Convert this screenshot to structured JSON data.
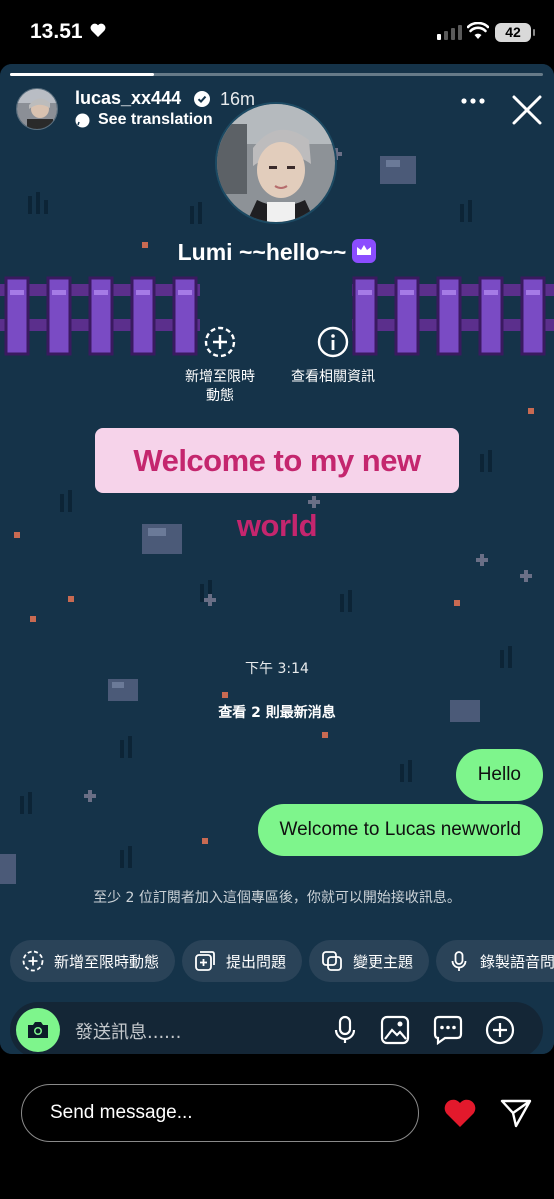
{
  "status_bar": {
    "time": "13.51",
    "battery": "42"
  },
  "story": {
    "progress": 0.27,
    "username": "lucas_xx444",
    "time_ago": "16m",
    "see_translation": "See translation",
    "channel_name": "Lumi ~~hello~~",
    "actions": [
      {
        "label": "新增至限時\n動態",
        "icon": "add-circle-dashed-icon"
      },
      {
        "label": "查看相關資訊",
        "icon": "info-icon"
      }
    ],
    "welcome_text": "Welcome to my new world",
    "timestamp": "下午 3:14",
    "new_messages": "查看 2 則最新消息",
    "bubbles": [
      "Hello",
      "Welcome to Lucas newworld"
    ],
    "notice": "至少 2 位訂閱者加入這個專區後，你就可以開始接收訊息。",
    "chips": [
      {
        "label": "新增至限時動態",
        "icon": "add-story-icon"
      },
      {
        "label": "提出問題",
        "icon": "question-icon"
      },
      {
        "label": "變更主題",
        "icon": "theme-icon"
      },
      {
        "label": "錄製語音問候",
        "icon": "mic-icon"
      }
    ],
    "composer_placeholder": "發送訊息......"
  },
  "reply": {
    "placeholder": "Send message..."
  },
  "colors": {
    "bubble": "#7ef58c",
    "banner_bg": "#f6d3ea",
    "banner_text": "#c4266e",
    "heart": "#e3192c",
    "bg": "#153349"
  }
}
